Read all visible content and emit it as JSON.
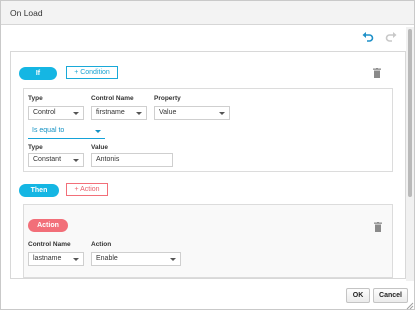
{
  "dialog": {
    "title": "On Load"
  },
  "toolbar": {
    "undo_icon": "undo-icon",
    "redo_icon": "redo-icon"
  },
  "if_block": {
    "if_label": "If",
    "add_condition_label": "+ Condition",
    "condition": {
      "type_label": "Type",
      "type_value": "Control",
      "control_name_label": "Control Name",
      "control_name_value": "firstname",
      "property_label": "Property",
      "property_value": "Value",
      "operator_value": "Is equal to",
      "value_type_label": "Type",
      "value_type_value": "Constant",
      "value_label": "Value",
      "value_value": "Antonis"
    }
  },
  "then_block": {
    "then_label": "Then",
    "add_action_label": "+ Action",
    "action": {
      "action_badge": "Action",
      "control_name_label": "Control Name",
      "control_name_value": "lastname",
      "action_label": "Action",
      "action_value": "Enable"
    }
  },
  "footer": {
    "ok_label": "OK",
    "cancel_label": "Cancel"
  },
  "colors": {
    "accent_blue": "#15b6e3",
    "accent_red": "#f26f79"
  }
}
